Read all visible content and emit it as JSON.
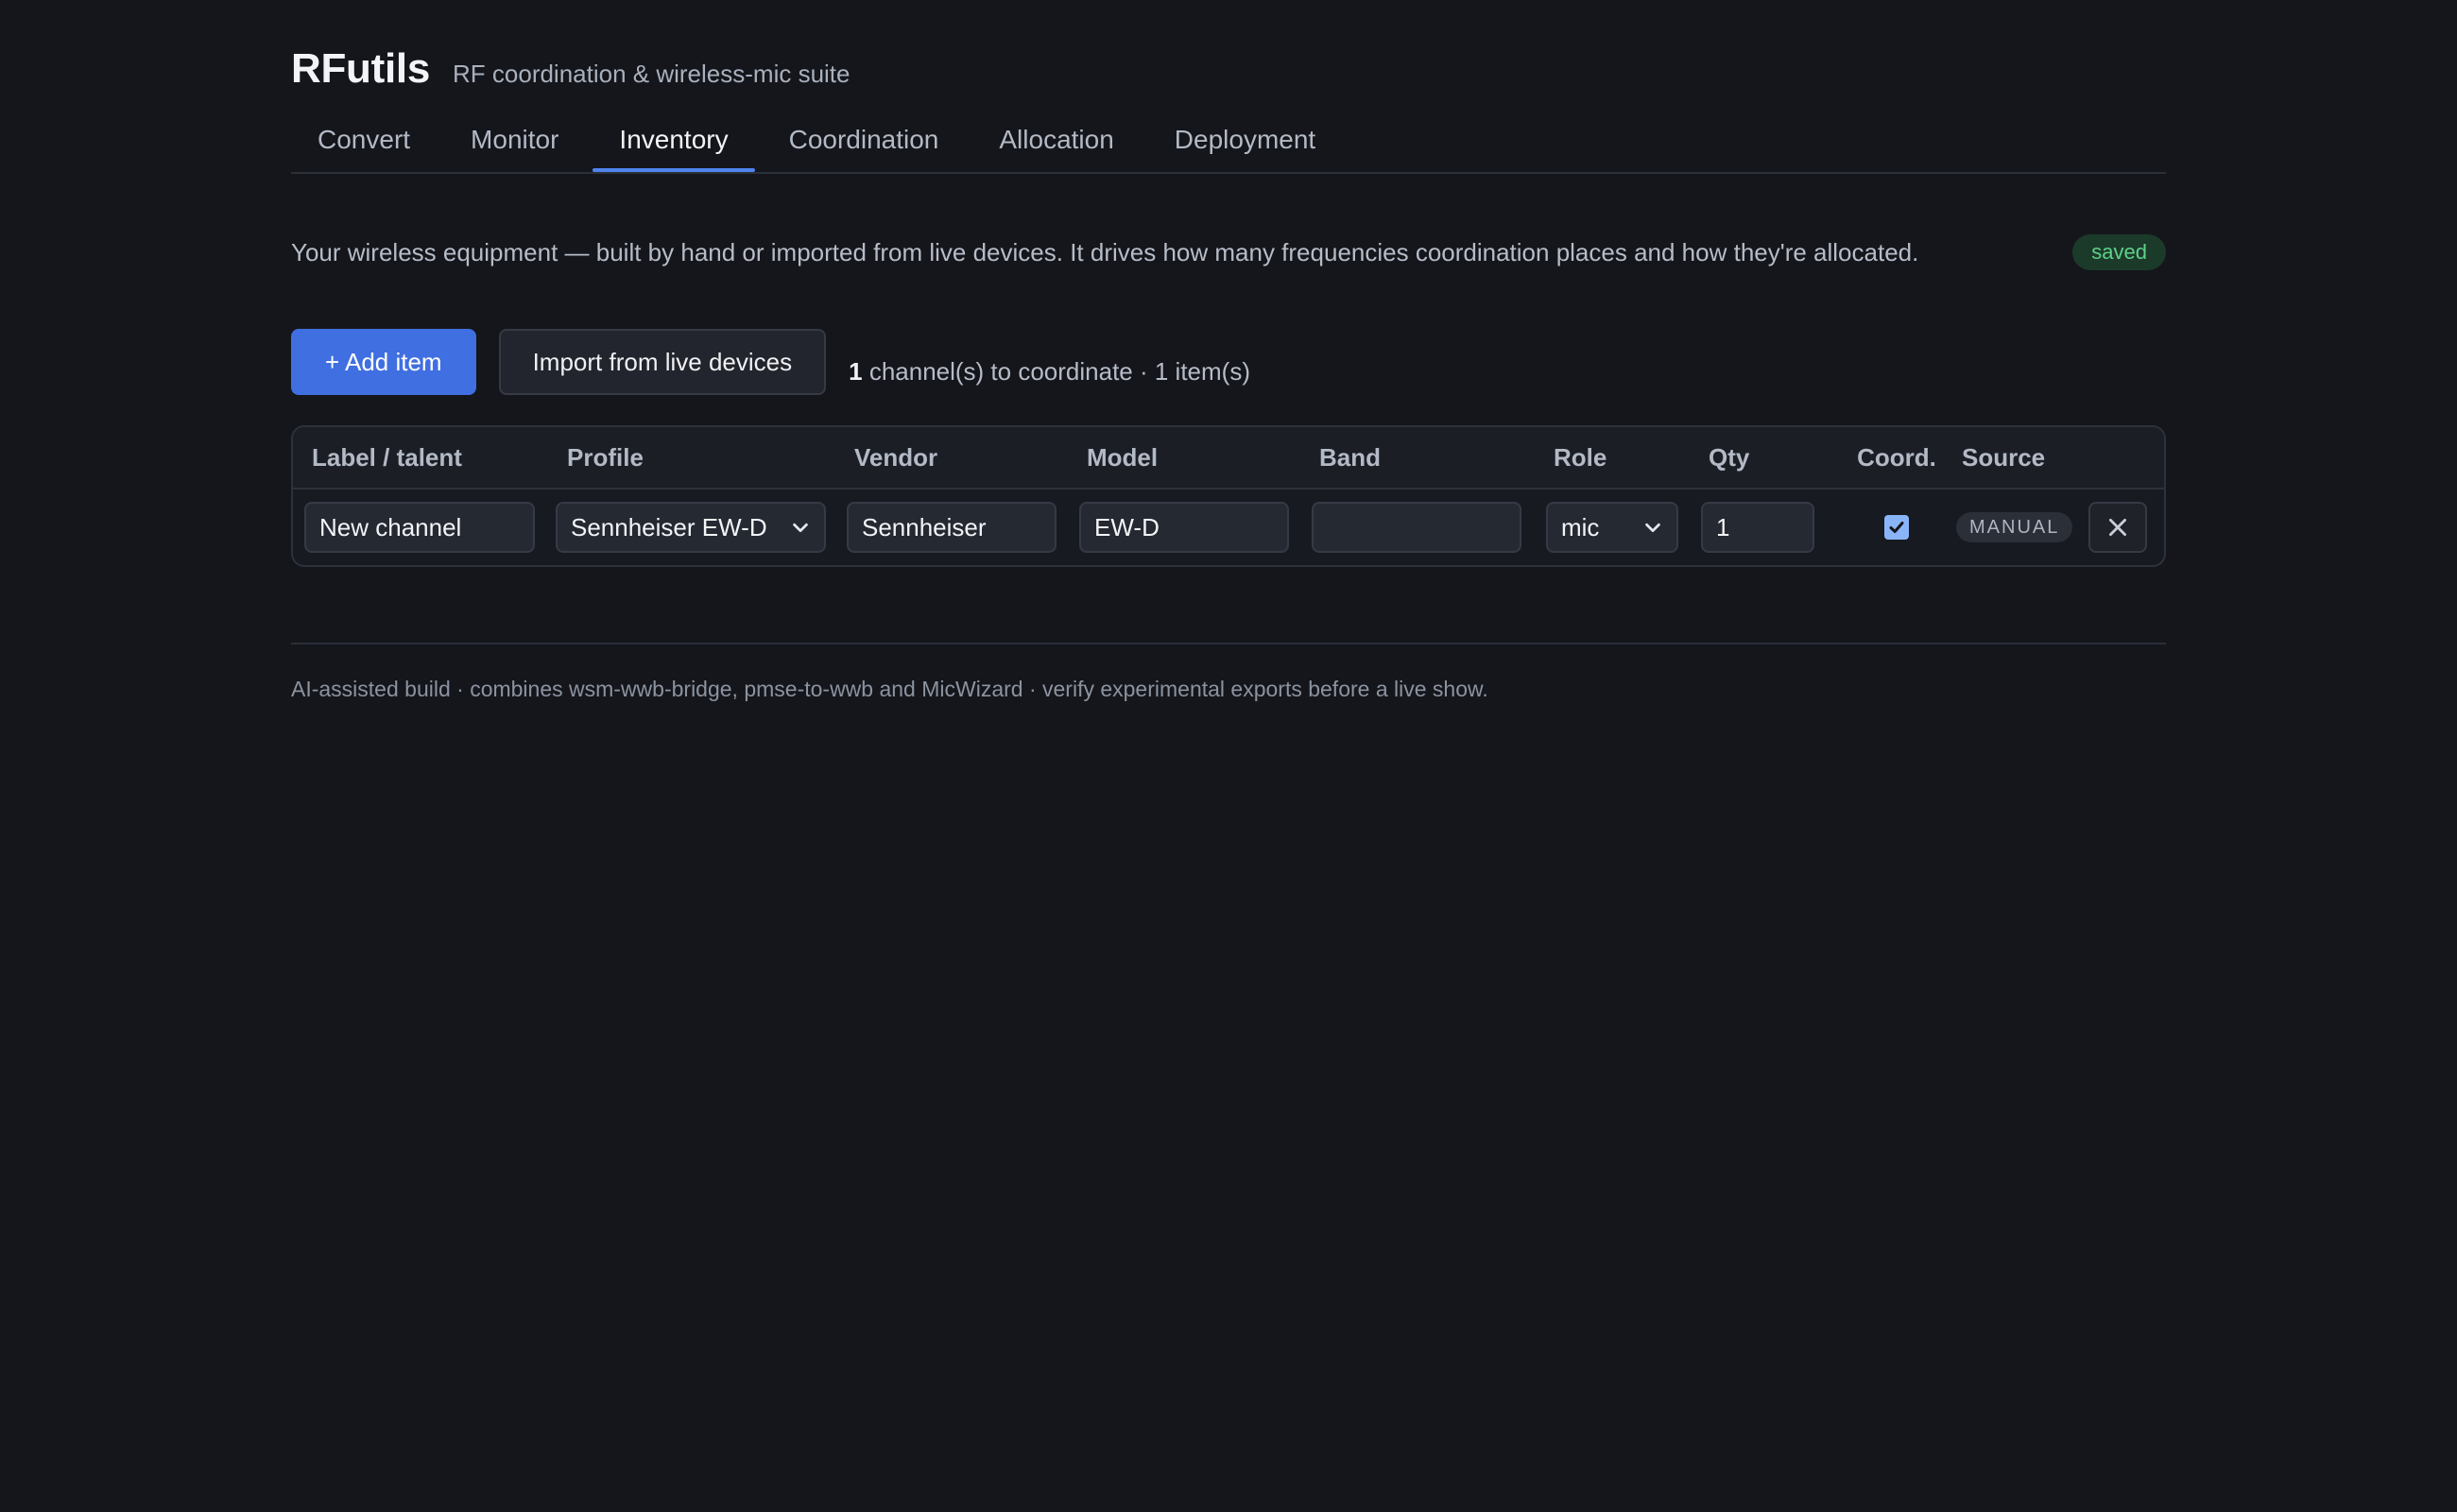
{
  "app": {
    "title": "RFutils",
    "subtitle": "RF coordination & wireless-mic suite"
  },
  "tabs": [
    {
      "label": "Convert"
    },
    {
      "label": "Monitor"
    },
    {
      "label": "Inventory",
      "active": true
    },
    {
      "label": "Coordination"
    },
    {
      "label": "Allocation"
    },
    {
      "label": "Deployment"
    }
  ],
  "intro": {
    "text": "Your wireless equipment — built by hand or imported from live devices. It drives how many frequencies coordination places and how they're allocated.",
    "status": "saved"
  },
  "actions": {
    "add_label": "+ Add item",
    "import_label": "Import from live devices"
  },
  "summary": {
    "channel_count": "1",
    "channel_text": "channel(s) to coordinate · 1 item(s)"
  },
  "table": {
    "headers": [
      "Label / talent",
      "Profile",
      "Vendor",
      "Model",
      "Band",
      "Role",
      "Qty",
      "Coord.",
      "Source"
    ],
    "rows": [
      {
        "label": "New channel",
        "profile": "Sennheiser EW-D",
        "vendor": "Sennheiser",
        "model": "EW-D",
        "band": "",
        "role": "mic",
        "qty": "1",
        "coord": true,
        "source": "MANUAL"
      }
    ]
  },
  "footer": {
    "text": "AI-assisted build · combines wsm-wwb-bridge, pmse-to-wwb and MicWizard · verify experimental exports before a live show."
  },
  "colors": {
    "accent": "#4f83ee",
    "primary_button": "#3f6fe0",
    "saved_text": "#5fd18a",
    "background": "#14161b"
  },
  "icons": {
    "select_chevron": "chevron-down-icon",
    "coord_check": "checkmark-icon",
    "delete": "close-icon"
  }
}
